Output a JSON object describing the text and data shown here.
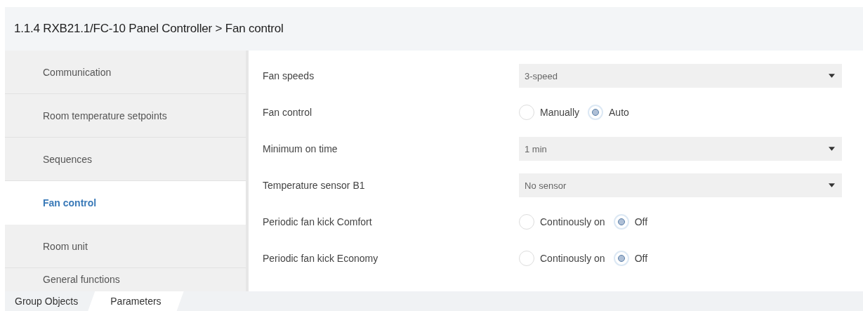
{
  "header": {
    "title": "1.1.4 RXB21.1/FC-10 Panel Controller > Fan control"
  },
  "sidebar": {
    "items": [
      {
        "label": "Communication",
        "selected": false
      },
      {
        "label": "Room temperature setpoints",
        "selected": false
      },
      {
        "label": "Sequences",
        "selected": false
      },
      {
        "label": "Fan control",
        "selected": true
      },
      {
        "label": "Room unit",
        "selected": false
      },
      {
        "label": "General functions",
        "selected": false
      }
    ]
  },
  "parameters": [
    {
      "label": "Fan speeds",
      "kind": "dropdown",
      "value": "3-speed"
    },
    {
      "label": "Fan control",
      "kind": "radio",
      "options": [
        {
          "label": "Manually",
          "selected": false
        },
        {
          "label": "Auto",
          "selected": true
        }
      ]
    },
    {
      "label": "Minimum on time",
      "kind": "dropdown",
      "value": "1 min"
    },
    {
      "label": "Temperature sensor B1",
      "kind": "dropdown",
      "value": "No sensor"
    },
    {
      "label": "Periodic fan kick Comfort",
      "kind": "radio",
      "options": [
        {
          "label": "Continously on",
          "selected": false
        },
        {
          "label": "Off",
          "selected": true
        }
      ]
    },
    {
      "label": "Periodic fan kick Economy",
      "kind": "radio",
      "options": [
        {
          "label": "Continously on",
          "selected": false
        },
        {
          "label": "Off",
          "selected": true
        }
      ]
    }
  ],
  "bottom_tabs": [
    {
      "label": "Group Objects",
      "selected": false
    },
    {
      "label": "Parameters",
      "selected": true
    }
  ]
}
